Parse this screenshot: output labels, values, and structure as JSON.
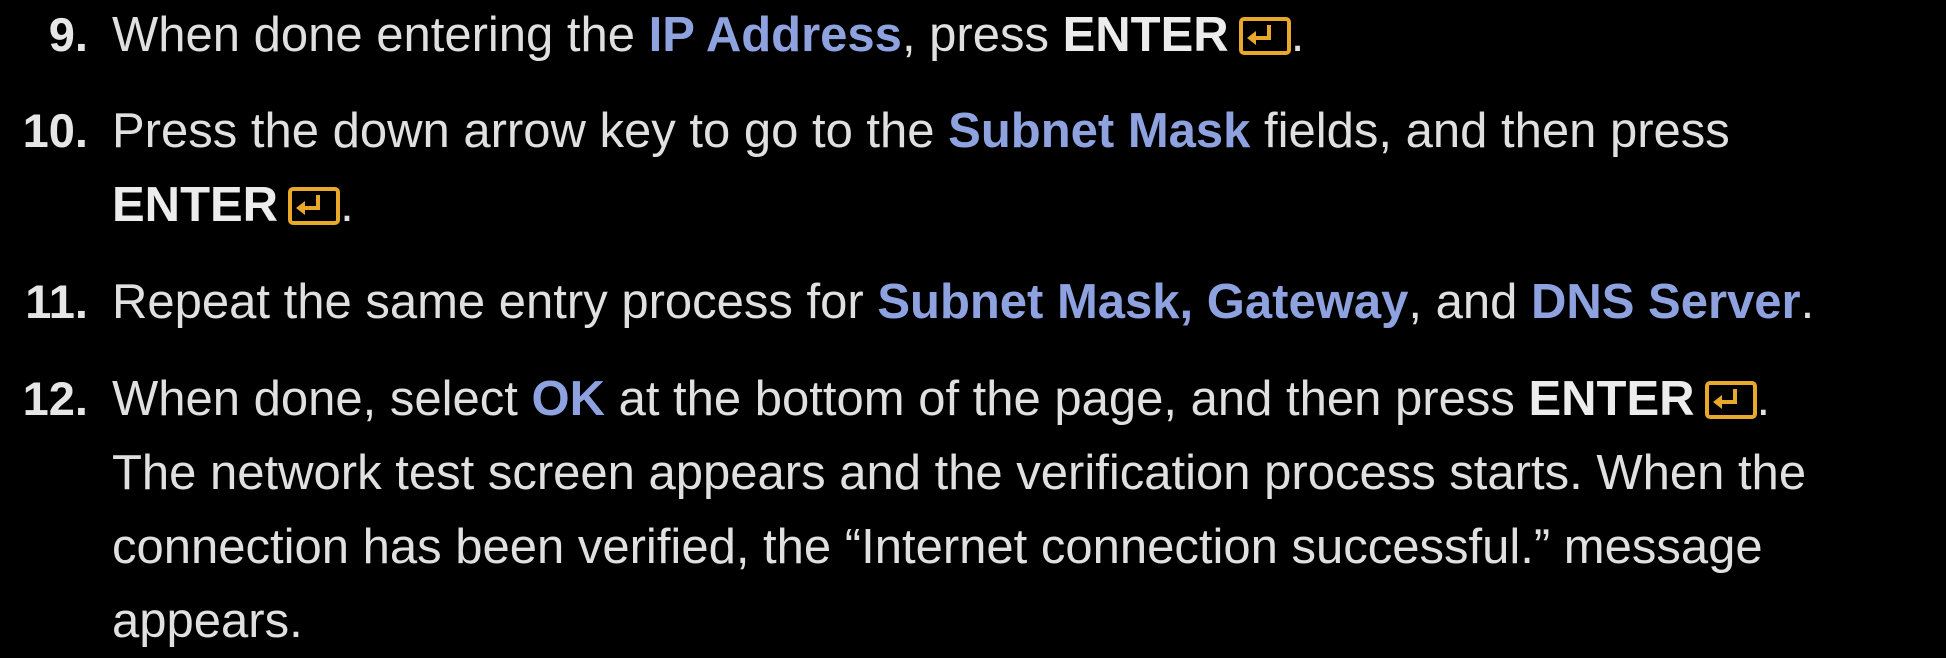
{
  "steps": [
    {
      "number": "9.",
      "text1": "When done entering the ",
      "highlight1": "IP Address",
      "text2": ", press ",
      "key": "ENTER",
      "end": "."
    },
    {
      "number": "10.",
      "text1": "Press the down arrow key to go to the ",
      "highlight1": "Subnet Mask",
      "text2": " fields, and then press",
      "key": "ENTER",
      "end": "."
    },
    {
      "number": "11.",
      "text1": "Repeat the same entry process for ",
      "highlight1": "Subnet Mask, Gateway",
      "text2": ", and ",
      "highlight2": "DNS Server",
      "end": "."
    },
    {
      "number": "12.",
      "text1": "When done, select ",
      "highlight1": "OK",
      "text2": " at the bottom of the page, and then press ",
      "key": "ENTER",
      "end": ".",
      "line2": "The network test screen appears and the verification process starts. When the",
      "line3": "connection has been verified, the “Internet connection successful.” message",
      "line4": "appears."
    }
  ],
  "colors": {
    "background": "#000000",
    "text": "#e0e0e0",
    "highlight": "#8ea2e0",
    "enter_icon": "#e8a82a"
  },
  "icons": {
    "enter": "enter-key-icon"
  }
}
